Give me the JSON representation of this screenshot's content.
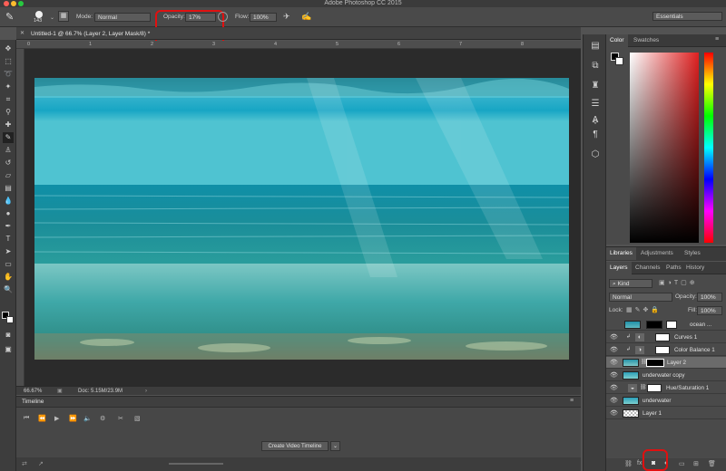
{
  "app": {
    "title": "Adobe Photoshop CC 2015",
    "workspace": "Essentials"
  },
  "options_bar": {
    "brush_size": "143",
    "mode_label": "Mode:",
    "mode_value": "Normal",
    "opacity_label": "Opacity:",
    "opacity_value": "17%",
    "flow_label": "Flow:",
    "flow_value": "100%"
  },
  "document": {
    "tab_label": "Untitled-1 @ 66.7% (Layer 2, Layer Mask/8) *",
    "zoom": "66.67%",
    "doc_info": "Doc: 5.15M/23.9M",
    "ruler_numbers": [
      "0",
      "1",
      "2",
      "3",
      "4",
      "5",
      "6",
      "7",
      "8",
      "9"
    ]
  },
  "timeline": {
    "title": "Timeline",
    "create_button": "Create Video Timeline"
  },
  "color_panel": {
    "tabs": [
      "Color",
      "Swatches"
    ]
  },
  "libraries_panel": {
    "tabs": [
      "Libraries",
      "Adjustments",
      "Styles"
    ]
  },
  "layers_panel": {
    "tabs": [
      "Layers",
      "Channels",
      "Paths",
      "History"
    ],
    "filter_kind": "Kind",
    "blend_mode": "Normal",
    "opacity_label": "Opacity:",
    "opacity_value": "100%",
    "lock_label": "Lock:",
    "fill_label": "Fill:",
    "fill_value": "100%",
    "layers": [
      {
        "name": "ocean ..."
      },
      {
        "name": "Curves 1"
      },
      {
        "name": "Color Balance 1"
      },
      {
        "name": "Layer 2"
      },
      {
        "name": "underwater copy"
      },
      {
        "name": "Hue/Saturation 1"
      },
      {
        "name": "underwater"
      },
      {
        "name": "Layer 1"
      }
    ]
  },
  "colors": {
    "highlight": "#e01010",
    "selected_layer": "#6b6b6b",
    "accent": "#2d7fd8"
  }
}
